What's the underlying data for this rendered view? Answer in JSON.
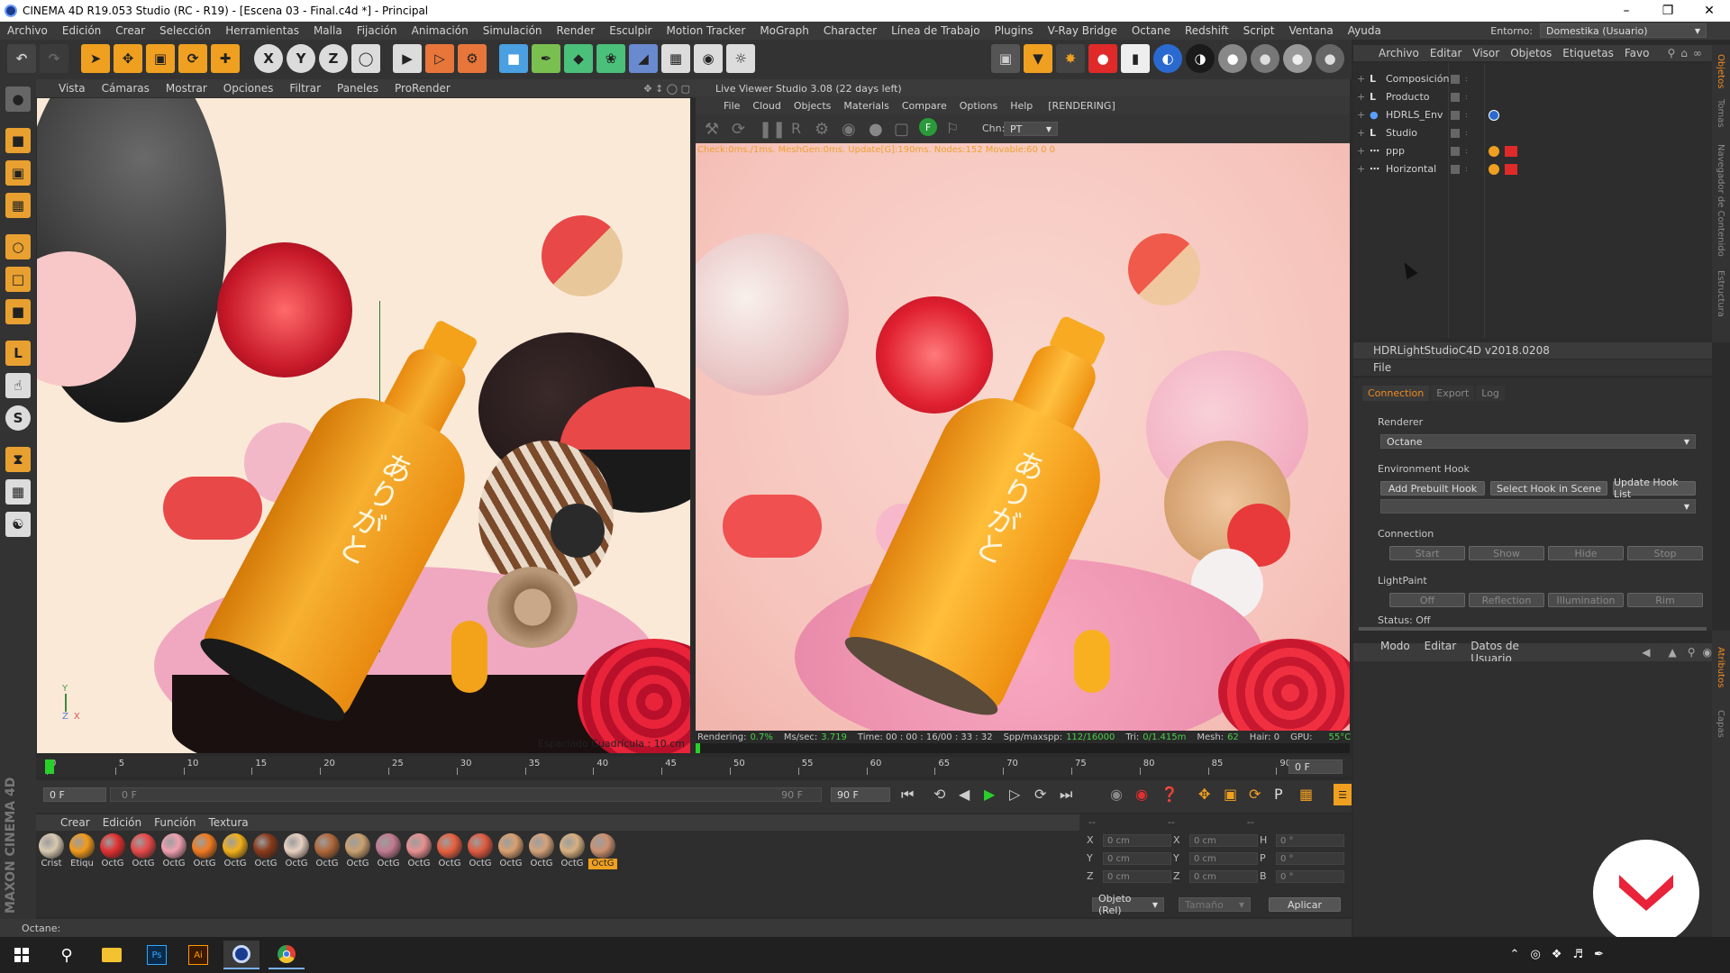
{
  "window": {
    "title": "CINEMA 4D R19.053 Studio (RC - R19) - [Escena 03 - Final.c4d *] - Principal"
  },
  "menu": [
    "Archivo",
    "Edición",
    "Crear",
    "Selección",
    "Herramientas",
    "Malla",
    "Fijación",
    "Animación",
    "Simulación",
    "Render",
    "Esculpir",
    "Motion Tracker",
    "MoGraph",
    "Character",
    "Línea de Trabajo",
    "Plugins",
    "V-Ray Bridge",
    "Octane",
    "Redshift",
    "Script",
    "Ventana",
    "Ayuda"
  ],
  "environment": {
    "label": "Entorno:",
    "value": "Domestika (Usuario)"
  },
  "viewport": {
    "menu": [
      "Vista",
      "Cámaras",
      "Mostrar",
      "Opciones",
      "Filtrar",
      "Paneles",
      "ProRender"
    ],
    "grid_label": "Espaciado Cuadrícula : 10 cm",
    "kanji": "ありがと",
    "axis_y": "Y",
    "axis_z": "Z",
    "axis_x": "X"
  },
  "live_viewer": {
    "title": "Live Viewer Studio 3.08 (22 days left)",
    "menu": [
      "File",
      "Cloud",
      "Objects",
      "Materials",
      "Compare",
      "Options",
      "Help"
    ],
    "status_tag": "[RENDERING]",
    "chn_label": "Chn:",
    "chn_value": "PT",
    "check_line": "Check:0ms./1ms. MeshGen:0ms. Update[G]:190ms. Nodes:152 Movable:60  0 0",
    "status_bar": {
      "rendering_label": "Rendering:",
      "rendering_value": "0.7%",
      "mssec_label": "Ms/sec:",
      "mssec_value": "3.719",
      "time_label": "Time: 00 : 00 : 16/00 : 33 : 32",
      "spp_label": "Spp/maxspp:",
      "spp_value": "112/16000",
      "tri_label": "Tri:",
      "tri_value": "0/1.415m",
      "mesh_label": "Mesh:",
      "mesh_value": "62",
      "hair_label": "Hair: 0",
      "gpu_label": "GPU:",
      "gpu_value": "55°C"
    }
  },
  "object_manager": {
    "menu": [
      "Archivo",
      "Editar",
      "Visor",
      "Objetos",
      "Etiquetas",
      "Favo"
    ],
    "objects": [
      {
        "name": "Composición",
        "icon": "layer-icon"
      },
      {
        "name": "Producto",
        "icon": "layer-icon"
      },
      {
        "name": "HDRLS_Env",
        "icon": "sky-icon"
      },
      {
        "name": "Studio",
        "icon": "layer-icon"
      },
      {
        "name": "ppp",
        "icon": "null-icon"
      },
      {
        "name": "Horizontal",
        "icon": "null-icon"
      }
    ],
    "side_tabs": [
      "Objetos",
      "Tomas",
      "Navegador de Contenido",
      "Estructura"
    ]
  },
  "hdr_panel": {
    "title": "HDRLightStudioC4D v2018.0208",
    "file_menu": "File",
    "tabs": [
      "Connection",
      "Export",
      "Log"
    ],
    "renderer_label": "Renderer",
    "renderer_value": "Octane",
    "env_hook_label": "Environment Hook",
    "buttons_hook": [
      "Add Prebuilt Hook",
      "Select Hook in Scene",
      "Update Hook List"
    ],
    "connection_label": "Connection",
    "buttons_conn": [
      "Start",
      "Show",
      "Hide",
      "Stop"
    ],
    "lightpaint_label": "LightPaint",
    "buttons_lp": [
      "Off",
      "Reflection",
      "Illumination",
      "Rim"
    ],
    "status": "Status: Off"
  },
  "attributes": {
    "menu": [
      "Modo",
      "Editar",
      "Datos de Usuario"
    ],
    "side_tabs": [
      "Atributos",
      "Capas"
    ]
  },
  "timeline": {
    "ticks": [
      "0",
      "5",
      "10",
      "15",
      "20",
      "25",
      "30",
      "35",
      "40",
      "45",
      "50",
      "55",
      "60",
      "65",
      "70",
      "75",
      "80",
      "85",
      "90"
    ],
    "current_frame": "0 F",
    "start_field": "0 F",
    "range_start": "0 F",
    "range_end": "90 F",
    "end_field": "90 F"
  },
  "material_manager": {
    "menu": [
      "Crear",
      "Edición",
      "Función",
      "Textura"
    ],
    "materials": [
      {
        "label": "Crist",
        "color": "#d8c9b0"
      },
      {
        "label": "Etiqu",
        "color": "#f29a1a"
      },
      {
        "label": "OctG",
        "color": "#e23030"
      },
      {
        "label": "OctG",
        "color": "#e84848"
      },
      {
        "label": "OctG",
        "color": "#f0a0b0"
      },
      {
        "label": "OctG",
        "color": "#f07a20"
      },
      {
        "label": "OctG",
        "color": "#f2b01a"
      },
      {
        "label": "OctG",
        "color": "#8a3a1a"
      },
      {
        "label": "OctG",
        "color": "#e8d0c0"
      },
      {
        "label": "OctG",
        "color": "#b0683a"
      },
      {
        "label": "OctG",
        "color": "#caa070"
      },
      {
        "label": "OctG",
        "color": "#c07a90"
      },
      {
        "label": "OctG",
        "color": "#e89090"
      },
      {
        "label": "OctG",
        "color": "#e86040"
      },
      {
        "label": "OctG",
        "color": "#e05a40"
      },
      {
        "label": "OctG",
        "color": "#d8a070"
      },
      {
        "label": "OctG",
        "color": "#d4a27a"
      },
      {
        "label": "OctG",
        "color": "#d8b080"
      },
      {
        "label": "OctG",
        "color": "#cc9070"
      }
    ]
  },
  "coordinates": {
    "header": [
      "--",
      "--",
      "--"
    ],
    "rows": [
      {
        "a_label": "X",
        "a_val": "0 cm",
        "b_label": "X",
        "b_val": "0 cm",
        "c_label": "H",
        "c_val": "0 °"
      },
      {
        "a_label": "Y",
        "a_val": "0 cm",
        "b_label": "Y",
        "b_val": "0 cm",
        "c_label": "P",
        "c_val": "0 °"
      },
      {
        "a_label": "Z",
        "a_val": "0 cm",
        "b_label": "Z",
        "b_val": "0 cm",
        "c_label": "B",
        "c_val": "0 °"
      }
    ],
    "mode": "Objeto (Rel)",
    "size": "Tamaño",
    "apply": "Aplicar"
  },
  "status_line": "Octane:",
  "brand_vertical": "MAXON CINEMA 4D",
  "colors": {
    "accent": "#f2a31a",
    "tab_active": "#f08a20",
    "domestika": "#e8233a"
  }
}
